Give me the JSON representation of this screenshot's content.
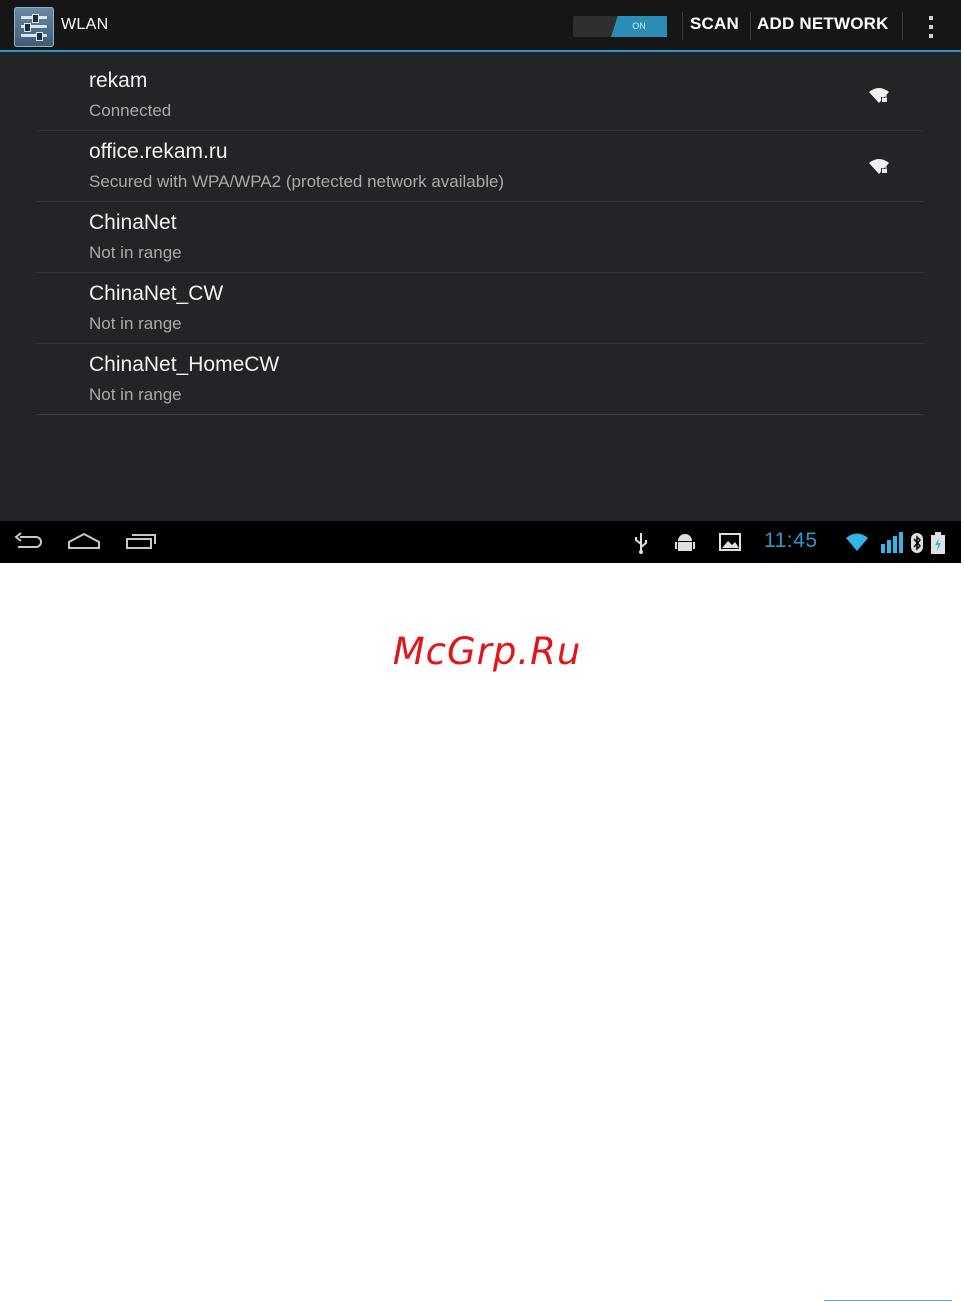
{
  "action_bar": {
    "title": "WLAN",
    "toggle_state": "ON",
    "scan_label": "SCAN",
    "add_network_label": "ADD NETWORK",
    "app_icon": "settings-sliders-icon",
    "overflow_icon": "overflow-menu-icon"
  },
  "networks": [
    {
      "name": "rekam",
      "status": "Connected",
      "signal_icon": true
    },
    {
      "name": "office.rekam.ru",
      "status": "Secured with WPA/WPA2 (protected network available)",
      "signal_icon": true
    },
    {
      "name": "ChinaNet",
      "status": "Not in range",
      "signal_icon": false
    },
    {
      "name": "ChinaNet_CW",
      "status": "Not in range",
      "signal_icon": false
    },
    {
      "name": "ChinaNet_HomeCW",
      "status": "Not in range",
      "signal_icon": false
    }
  ],
  "system_bar": {
    "time": "11:45",
    "nav_icons": [
      "back-icon",
      "home-icon",
      "recent-apps-icon"
    ],
    "status_icons": [
      "usb-icon",
      "android-debug-icon",
      "screenshot-icon",
      "wifi-status-icon",
      "signal-bars-icon",
      "bluetooth-icon",
      "battery-icon"
    ]
  },
  "watermark": {
    "text": "McGrp.Ru"
  },
  "colors": {
    "accent": "#33b5e5",
    "background": "#232427",
    "watermark": "#e0161b"
  }
}
